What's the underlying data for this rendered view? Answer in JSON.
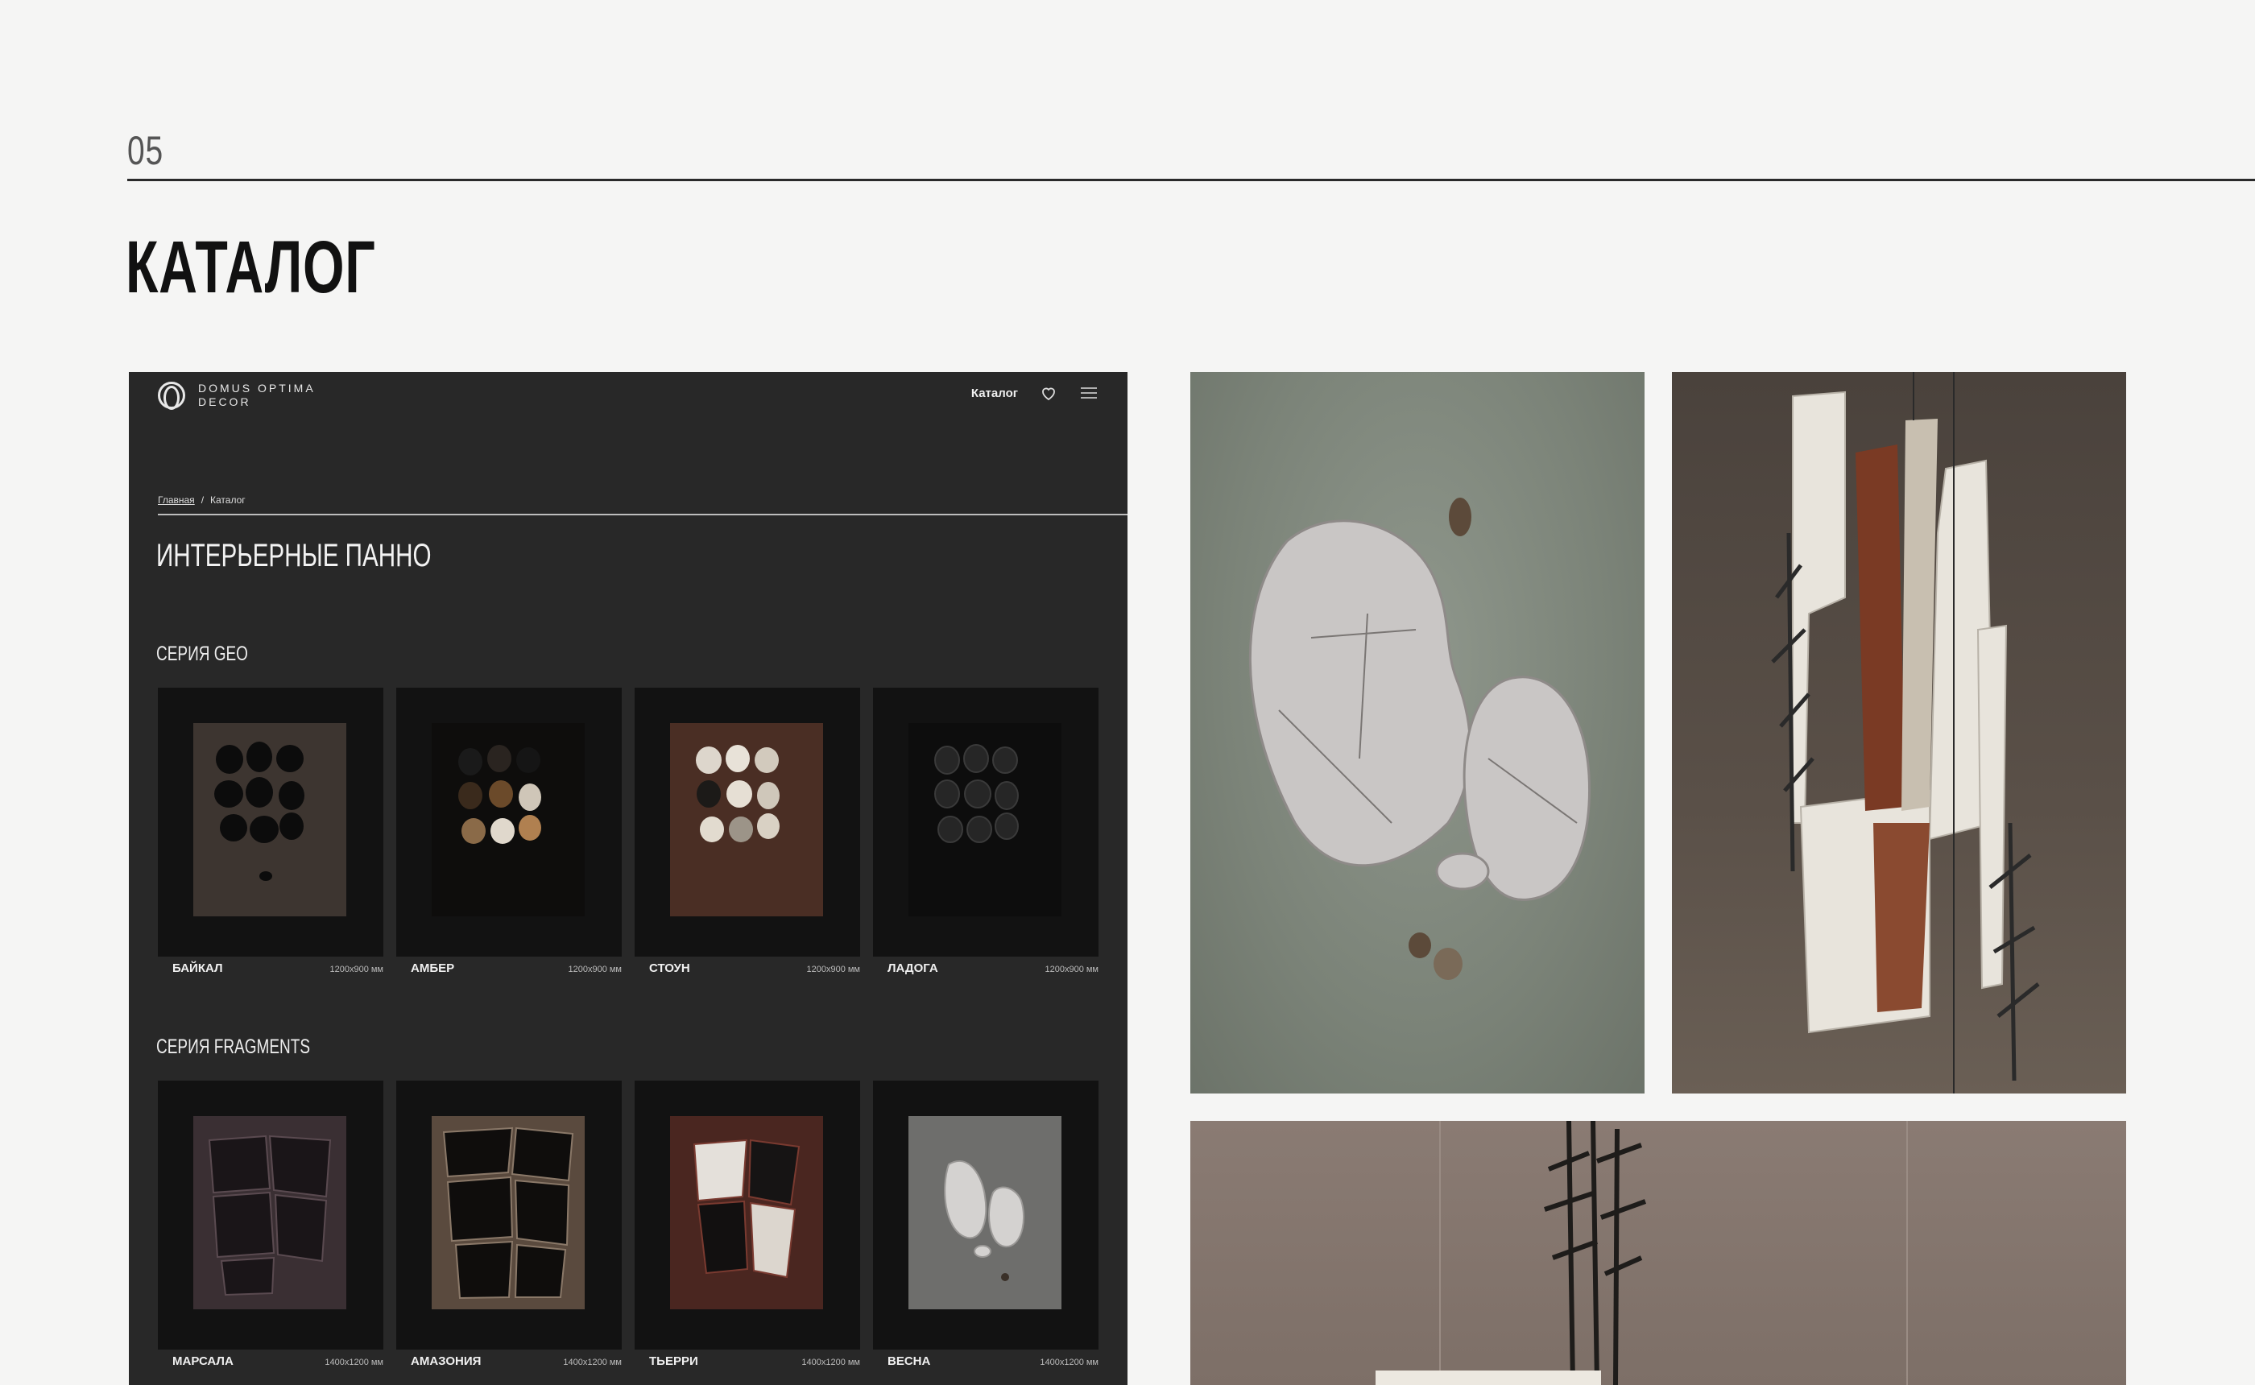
{
  "section": {
    "number": "05",
    "title": "КАТАЛОГ"
  },
  "mock": {
    "logo": {
      "line1": "DOMUS OPTIMA",
      "line2": "DECOR"
    },
    "nav": {
      "catalog_link": "Каталог",
      "icons": [
        "heart-icon",
        "menu-icon"
      ]
    },
    "breadcrumbs": {
      "home": "Главная",
      "separator": "/",
      "current": "Каталог"
    },
    "heading": "ИНТЕРЬЕРНЫЕ ПАННО",
    "series": [
      {
        "title": "СЕРИЯ GEO",
        "items": [
          {
            "name": "БАЙКАЛ",
            "size": "1200x900 мм"
          },
          {
            "name": "АМБЕР",
            "size": "1200x900 мм"
          },
          {
            "name": "СТОУН",
            "size": "1200x900 мм"
          },
          {
            "name": "ЛАДОГА",
            "size": "1200x900 мм"
          }
        ]
      },
      {
        "title": "СЕРИЯ FRAGMENTS",
        "items": [
          {
            "name": "МАРСАЛА",
            "size": "1400x1200 мм"
          },
          {
            "name": "АМАЗОНИЯ",
            "size": "1400x1200 мм"
          },
          {
            "name": "ТЬЕРРИ",
            "size": "1400x1200 мм"
          },
          {
            "name": "ВЕСНА",
            "size": "1400x1200 мм"
          }
        ]
      }
    ]
  },
  "colors": {
    "page_bg": "#f5f5f4",
    "mock_bg": "#282828",
    "text_dark": "#111111"
  }
}
